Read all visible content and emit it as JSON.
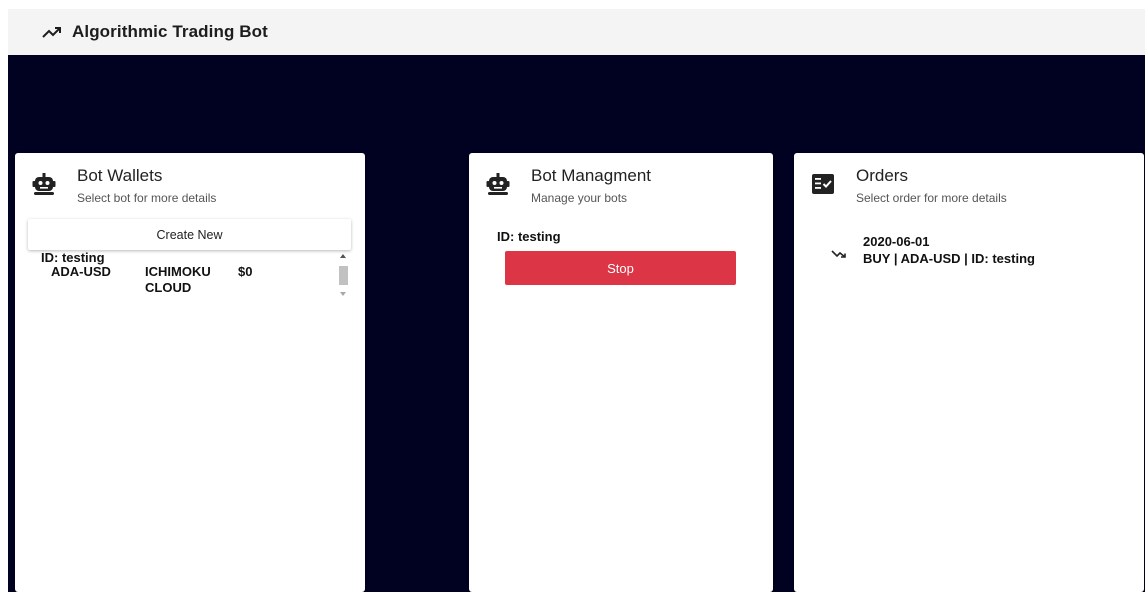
{
  "app": {
    "title": "Algorithmic Trading Bot",
    "icon": "trending-up-icon"
  },
  "colors": {
    "background": "#010121",
    "appbar": "#f4f4f4",
    "stop_button": "#dc3545"
  },
  "wallets": {
    "title": "Bot Wallets",
    "subtitle": "Select bot for more details",
    "icon": "robot-icon",
    "create_label": "Create New",
    "items": [
      {
        "id": "ID: testing",
        "pair": "ADA-USD",
        "strategy": "ICHIMOKU CLOUD",
        "value": "$0"
      }
    ]
  },
  "management": {
    "title": "Bot Managment",
    "subtitle": "Manage your bots",
    "icon": "robot-icon",
    "bot_id": "ID: testing",
    "stop_label": "Stop"
  },
  "orders": {
    "title": "Orders",
    "subtitle": "Select order for more details",
    "icon": "checklist-icon",
    "items": [
      {
        "date": "2020-06-01",
        "description": "BUY | ADA-USD | ID: testing",
        "icon": "arrow-down-right-icon"
      }
    ]
  }
}
